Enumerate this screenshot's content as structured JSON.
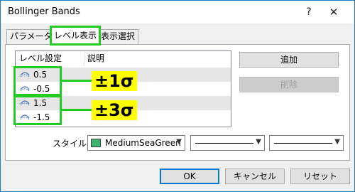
{
  "window": {
    "title": "Bollinger Bands"
  },
  "titlebar": {
    "help": "?",
    "close": "✕"
  },
  "tabs": [
    {
      "label": "パラメーター"
    },
    {
      "label": "レベル表示"
    },
    {
      "label": "表示選択"
    }
  ],
  "levels_table": {
    "headers": [
      "レベル設定",
      "説明"
    ],
    "rows": [
      {
        "value": "0.5",
        "description": ""
      },
      {
        "value": "-0.5",
        "description": ""
      },
      {
        "value": "1.5",
        "description": ""
      },
      {
        "value": "-1.5",
        "description": ""
      }
    ]
  },
  "annotations": [
    {
      "text": "±1σ"
    },
    {
      "text": "±3σ"
    }
  ],
  "side_buttons": {
    "add": "追加",
    "delete": "削除"
  },
  "style_row": {
    "label": "スタイル：",
    "color_name": "MediumSeaGreen",
    "color_hex": "#3cb371"
  },
  "footer": {
    "ok": "OK",
    "cancel": "キャンセル",
    "reset": "リセット"
  },
  "colors": {
    "highlight": "#22cc22",
    "accent": "#0078d7"
  }
}
